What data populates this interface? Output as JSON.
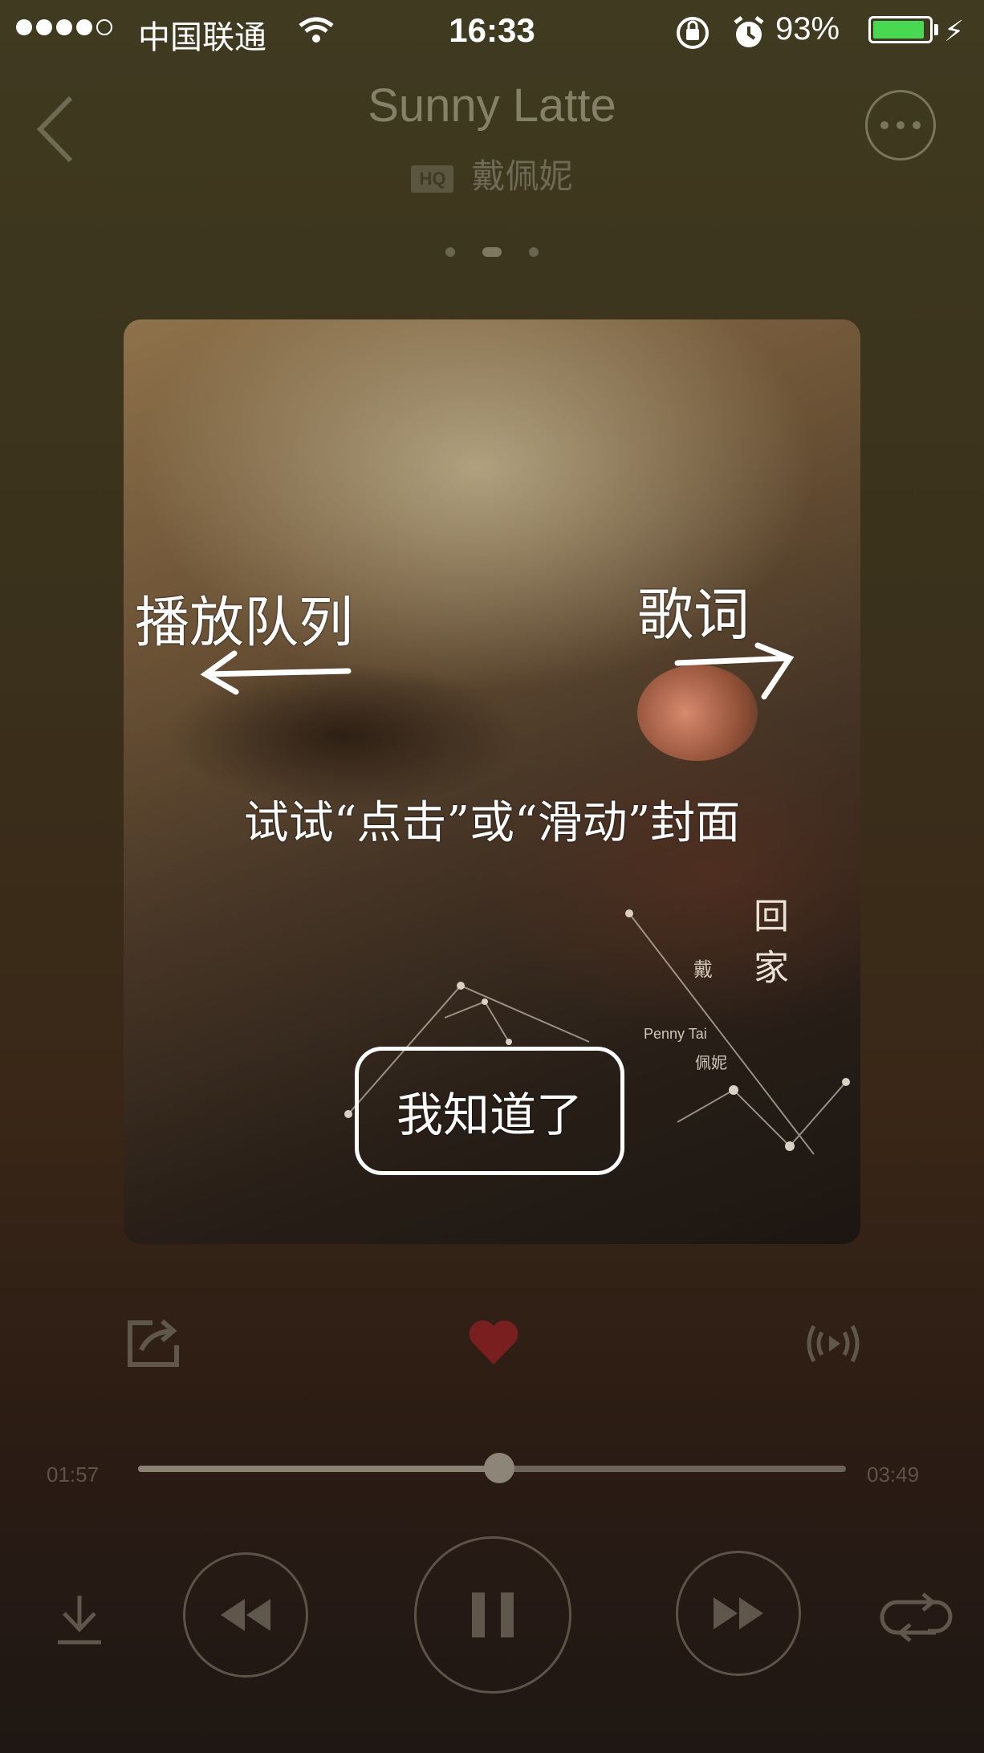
{
  "status_bar": {
    "signal_dots": 5,
    "signal_filled": 4,
    "carrier": "中国联通",
    "time": "16:33",
    "battery_percent": "93%",
    "battery_level": 0.93,
    "battery_color": "#49d851"
  },
  "header": {
    "back_icon": "chevron-left-icon",
    "song_title": "Sunny Latte",
    "quality_badge": "HQ",
    "artist": "戴佩妮",
    "more_icon": "more-icon"
  },
  "pager": {
    "pages": 3,
    "active": 1
  },
  "cover": {
    "queue_label": "播放队列",
    "lyrics_label": "歌词",
    "hint_text": "试试“点击”或“滑动”封面",
    "dismiss_button": "我知道了",
    "album_title": "回家",
    "album_artist": "戴",
    "album_artist_en": "Penny Tai",
    "album_artist_cn": "佩妮"
  },
  "actions": {
    "share_icon": "share-icon",
    "like_icon": "heart-icon",
    "like_color": "#7a1f1f",
    "cast_icon": "cast-icon"
  },
  "progress": {
    "current": "01:57",
    "total": "03:49",
    "fraction": 0.51
  },
  "controls": {
    "download_icon": "download-icon",
    "prev_icon": "previous-icon",
    "play_pause_icon": "pause-icon",
    "next_icon": "next-icon",
    "loop_icon": "repeat-icon"
  }
}
